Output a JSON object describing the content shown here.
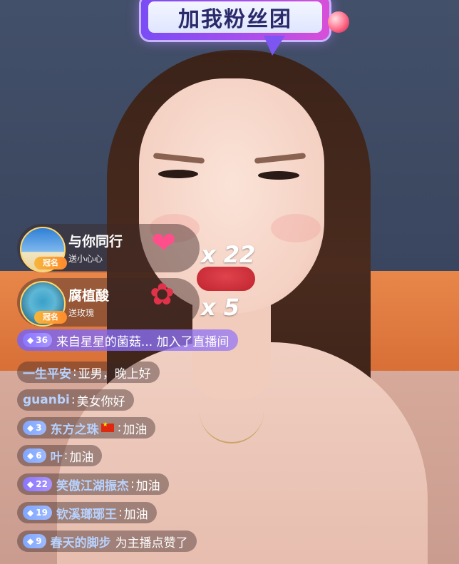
{
  "banner": {
    "text": "加我粉丝团"
  },
  "gifts": [
    {
      "user": "与你同行",
      "action": "送小心心",
      "badge": "冠名",
      "gift_icon": "heart-gift-icon",
      "count": "x 22"
    },
    {
      "user": "腐植酸",
      "action": "送玫瑰",
      "badge": "冠名",
      "gift_icon": "rose-gift-icon",
      "count": "x 5"
    }
  ],
  "join_notice": {
    "level": "36",
    "text": "来自星星的菌菇... 加入了直播间"
  },
  "chat": [
    {
      "user": "一生平安",
      "message": "亚男，晚上好",
      "level": ""
    },
    {
      "user": "guanbi",
      "message": "美女你好",
      "level": ""
    },
    {
      "user": "东方之珠",
      "message": "加油",
      "level": "3",
      "flag": "china-flag-icon"
    },
    {
      "user": "叶",
      "message": "加油",
      "level": "6"
    },
    {
      "user": "笑傲江湖振杰",
      "message": "加油",
      "level": "22"
    },
    {
      "user": "钦溪瑯琊王",
      "message": "加油",
      "level": "19"
    },
    {
      "user": "春天的脚步",
      "message": "为主播点赞了",
      "level": "9"
    }
  ],
  "colors": {
    "username": "#b7d2ff",
    "join_bg": "#8a78f0",
    "banner": "#8a4ef2"
  }
}
